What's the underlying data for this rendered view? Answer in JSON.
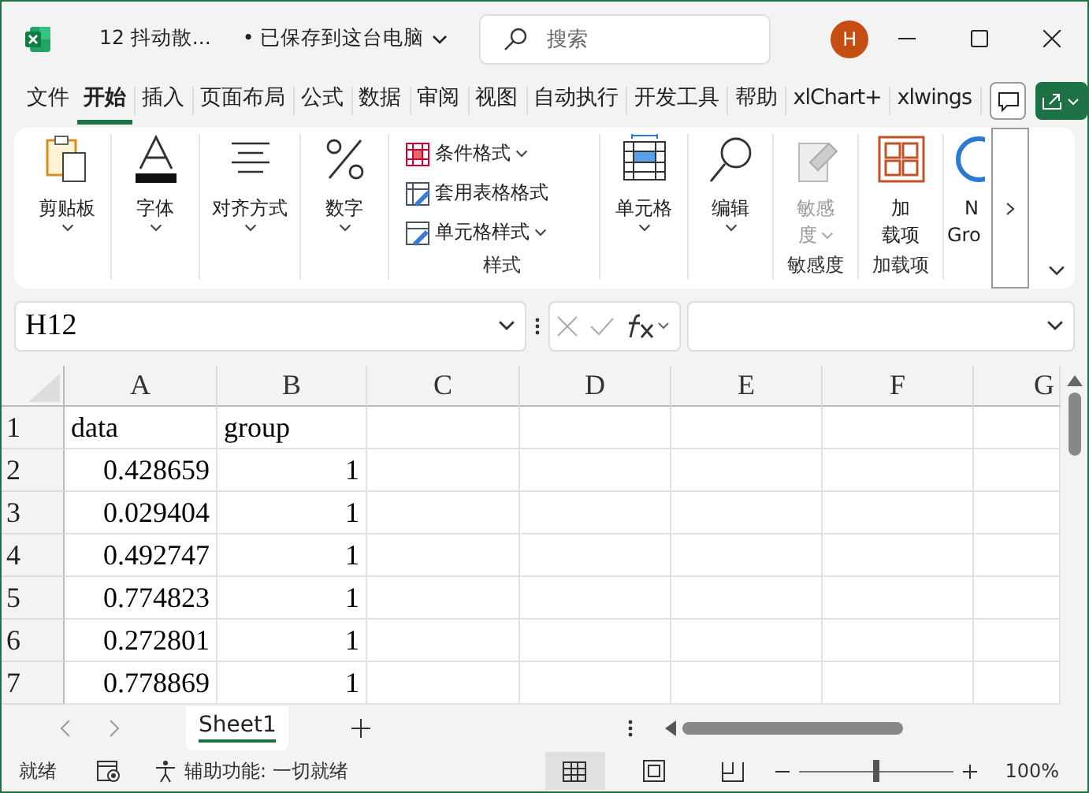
{
  "window": {
    "file_name": "12 抖动散...",
    "save_status": "• 已保存到这台电脑",
    "avatar": "H"
  },
  "search": {
    "placeholder": "搜索"
  },
  "menu_tabs": [
    {
      "label": "文件",
      "selected": false
    },
    {
      "label": "开始",
      "selected": true
    },
    {
      "label": "插入",
      "selected": false
    },
    {
      "label": "页面布局",
      "selected": false
    },
    {
      "label": "公式",
      "selected": false
    },
    {
      "label": "数据",
      "selected": false
    },
    {
      "label": "审阅",
      "selected": false
    },
    {
      "label": "视图",
      "selected": false
    },
    {
      "label": "自动执行",
      "selected": false
    },
    {
      "label": "开发工具",
      "selected": false
    },
    {
      "label": "帮助",
      "selected": false
    },
    {
      "label": "xlChart+",
      "selected": false
    },
    {
      "label": "xlwings",
      "selected": false
    }
  ],
  "ribbon": {
    "groups": [
      {
        "kind": "large",
        "buttons": [
          {
            "label": "剪贴板",
            "disabled": false
          }
        ]
      },
      {
        "kind": "large",
        "buttons": [
          {
            "label": "字体",
            "disabled": false
          }
        ]
      },
      {
        "kind": "large",
        "buttons": [
          {
            "label": "对齐方式",
            "disabled": false
          }
        ]
      },
      {
        "kind": "large",
        "buttons": [
          {
            "label": "数字",
            "disabled": false
          }
        ]
      },
      {
        "kind": "stacked",
        "label": "样式",
        "buttons": [
          {
            "label": "条件格式"
          },
          {
            "label": "套用表格格式"
          },
          {
            "label": "单元格样式"
          }
        ]
      },
      {
        "kind": "large",
        "buttons": [
          {
            "label": "单元格",
            "disabled": false
          }
        ]
      },
      {
        "kind": "large",
        "buttons": [
          {
            "label": "编辑",
            "disabled": false
          }
        ]
      },
      {
        "kind": "tall",
        "label": "敏感度",
        "buttons": [
          {
            "lines": [
              "敏感",
              "度"
            ],
            "disabled": true
          }
        ]
      },
      {
        "kind": "tall",
        "label": "加载项",
        "buttons": [
          {
            "lines": [
              "加",
              "载项"
            ],
            "disabled": false
          }
        ]
      },
      {
        "kind": "cut",
        "buttons": [
          {
            "lines": [
              "N",
              "Gro"
            ]
          }
        ]
      }
    ]
  },
  "formula_bar": {
    "name_box": "H12"
  },
  "sheet": {
    "columns": [
      "A",
      "B",
      "C",
      "D",
      "E",
      "F",
      "G"
    ],
    "rows": [
      {
        "header": "1",
        "cells": [
          {
            "kind": "text",
            "value": "data"
          },
          {
            "kind": "text",
            "value": "group"
          }
        ]
      },
      {
        "header": "2",
        "cells": [
          {
            "kind": "number",
            "value": "0.428659"
          },
          {
            "kind": "number",
            "value": "1"
          }
        ]
      },
      {
        "header": "3",
        "cells": [
          {
            "kind": "number",
            "value": "0.029404"
          },
          {
            "kind": "number",
            "value": "1"
          }
        ]
      },
      {
        "header": "4",
        "cells": [
          {
            "kind": "number",
            "value": "0.492747"
          },
          {
            "kind": "number",
            "value": "1"
          }
        ]
      },
      {
        "header": "5",
        "cells": [
          {
            "kind": "number",
            "value": "0.774823"
          },
          {
            "kind": "number",
            "value": "1"
          }
        ]
      },
      {
        "header": "6",
        "cells": [
          {
            "kind": "number",
            "value": "0.272801"
          },
          {
            "kind": "number",
            "value": "1"
          }
        ]
      },
      {
        "header": "7",
        "cells": [
          {
            "kind": "number",
            "value": "0.778869"
          },
          {
            "kind": "number",
            "value": "1"
          }
        ]
      }
    ]
  },
  "sheet_tabs": [
    {
      "label": "Sheet1",
      "selected": true
    }
  ],
  "status_bar": {
    "status": "就绪",
    "accessibility": "辅助功能: 一切就绪",
    "zoom": {
      "level": 0.5,
      "reading": "100%"
    }
  }
}
